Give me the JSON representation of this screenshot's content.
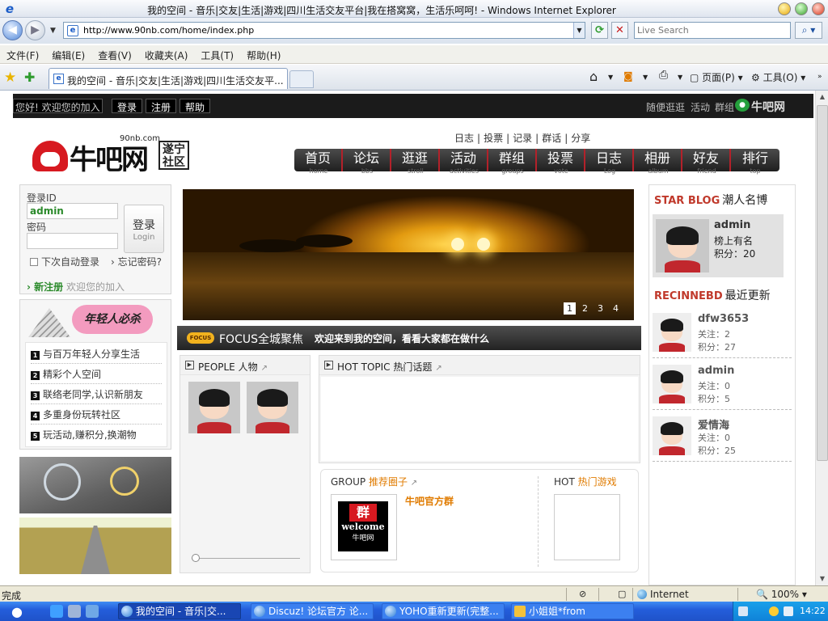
{
  "browser": {
    "window_title": "我的空间 - 音乐|交友|生活|游戏|四川生活交友平台|我在搭窝窝，生活乐呵呵! - Windows Internet Explorer",
    "url": "http://www.90nb.com/home/index.php",
    "search_placeholder": "Live Search",
    "menu": [
      "文件(F)",
      "编辑(E)",
      "查看(V)",
      "收藏夹(A)",
      "工具(T)",
      "帮助(H)"
    ],
    "tab_title": "我的空间 - 音乐|交友|生活|游戏|四川生活交友平...",
    "toolbar_page": "页面(P)",
    "toolbar_tools": "工具(O)",
    "status_text": "完成",
    "zone": "Internet",
    "zoom": "100%"
  },
  "site": {
    "topbar": {
      "greeting": "您好! 欢迎您的加入",
      "login": "登录",
      "register": "注册",
      "help": "帮助",
      "links": [
        "随便逛逛",
        "活动",
        "群组"
      ],
      "mini_logo": "牛吧网"
    },
    "logo": {
      "brand": "牛吧网",
      "domain": "90nb.com",
      "region": "遂宁社区"
    },
    "subnav": [
      "日志",
      "投票",
      "记录",
      "群话",
      "分享"
    ],
    "mainnav": [
      {
        "label": "首页",
        "en": "home"
      },
      {
        "label": "论坛",
        "en": "bbs"
      },
      {
        "label": "逛逛",
        "en": "stroll"
      },
      {
        "label": "活动",
        "en": "activities"
      },
      {
        "label": "群组",
        "en": "groups"
      },
      {
        "label": "投票",
        "en": "vote"
      },
      {
        "label": "日志",
        "en": "Log"
      },
      {
        "label": "相册",
        "en": "album"
      },
      {
        "label": "好友",
        "en": "friend"
      },
      {
        "label": "排行",
        "en": "top"
      }
    ],
    "login": {
      "id_label": "登录ID",
      "id_value": "admin",
      "pw_label": "密码",
      "btn_zh": "登录",
      "btn_en": "Login",
      "remember": "下次自动登录",
      "forgot": "忘记密码?",
      "new_reg": "新注册",
      "new_reg_sub": "欢迎您的加入"
    },
    "youth": {
      "title": "年轻人必杀",
      "items": [
        "与百万年轻人分享生活",
        "精彩个人空间",
        "联络老同学,认识新朋友",
        "多重身份玩转社区",
        "玩活动,赚积分,换潮物"
      ]
    },
    "banner_pages": [
      "1",
      "2",
      "3",
      "4"
    ],
    "focus": {
      "tag": "FOCUS",
      "title": "FOCUS全城聚焦",
      "text": "欢迎来到我的空间，看看大家都在做什么"
    },
    "people_title": "PEOPLE 人物",
    "hot_topic_title": "HOT TOPIC 热门话题",
    "group": {
      "title_en": "GROUP",
      "title_zh": "推荐圈子",
      "name": "牛吧官方群",
      "thumb_q": "群",
      "thumb_w": "welcome",
      "thumb_n": "牛吧网"
    },
    "hot_games": {
      "title_en": "HOT",
      "title_zh": "热门游戏"
    },
    "star_blog": {
      "title_en": "STAR BLOG",
      "title_zh": "潮人名博",
      "name": "admin",
      "line1": "榜上有名",
      "line2": "积分：20"
    },
    "recent": {
      "title_en": "RECINNEBD",
      "title_zh": "最近更新",
      "users": [
        {
          "name": "dfw3653",
          "follow": "关注：2",
          "score": "积分：27"
        },
        {
          "name": "admin",
          "follow": "关注：0",
          "score": "积分：5"
        },
        {
          "name": "爱情海",
          "follow": "关注：0",
          "score": "积分：25"
        }
      ]
    }
  },
  "taskbar": {
    "tasks": [
      "我的空间 - 音乐|交...",
      "Discuz! 论坛官方 论...",
      "YOHO重新更新(完整...",
      "小姐姐*from"
    ],
    "clock": "14:22"
  }
}
